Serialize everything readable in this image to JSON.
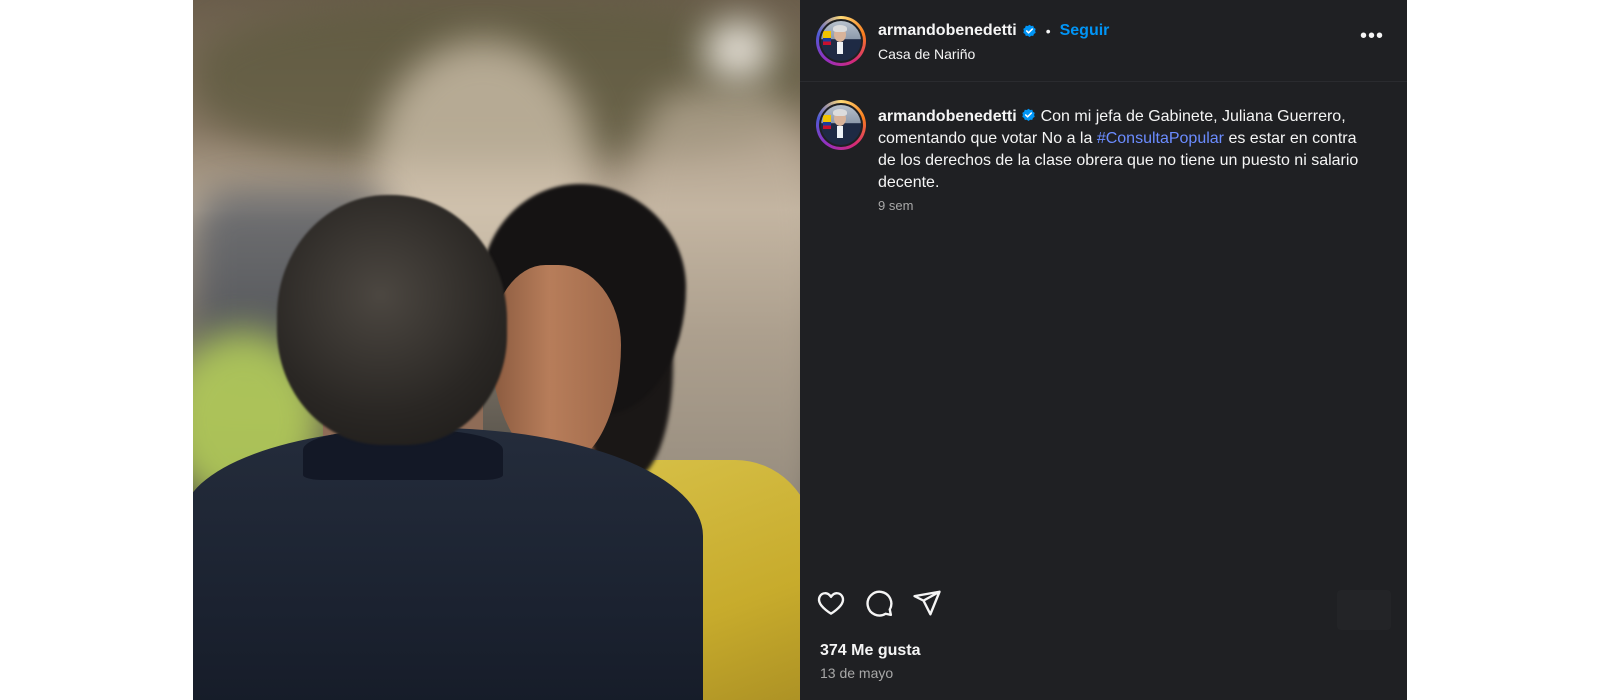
{
  "post": {
    "username": "armandobenedetti",
    "separator": "•",
    "follow_label": "Seguir",
    "location": "Casa de Nariño",
    "more_label": "•••",
    "caption": {
      "text_before": "Con mi jefa de Gabinete, Juliana Guerrero, comentando que votar No a la ",
      "hashtag": "#ConsultaPopular",
      "text_after": " es estar en contra de los derechos de la clase obrera que no tiene un puesto ni salario decente."
    },
    "time_ago": "9 sem",
    "likes": "374 Me gusta",
    "date": "13 de mayo"
  },
  "icons": {
    "verified": "verified-badge-icon",
    "like": "heart-icon",
    "comment": "comment-icon",
    "share": "share-icon",
    "more": "more-options-icon"
  },
  "colors": {
    "panel_bg": "#1f2023",
    "follow": "#0095f6",
    "hashtag": "#6b8cff",
    "secondary_text": "#a8a8a8"
  }
}
